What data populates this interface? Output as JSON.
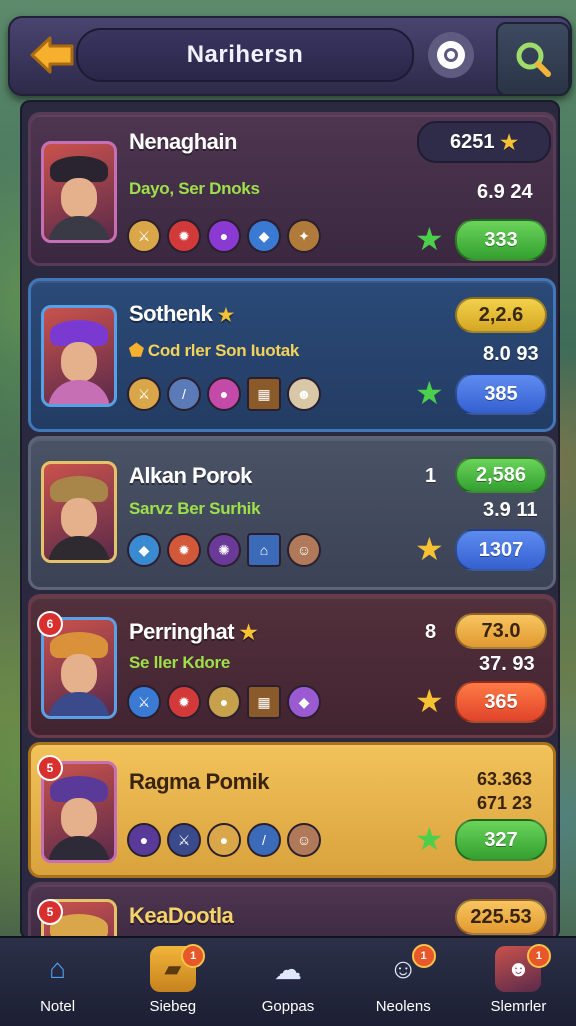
{
  "header": {
    "title": "Narihersn"
  },
  "cards": [
    {
      "name": "Nenaghain",
      "sub": "Dayo, Ser Dnoks",
      "value_top": "6251",
      "value_mid": "6.9 24",
      "button": "333",
      "sub_color": "#9ee04a"
    },
    {
      "name": "Sothenk",
      "sub": "Cod rler Son Iuotak",
      "value_top": "2,2.6",
      "value_mid": "8.0 93",
      "button": "385",
      "sub_color": "#f4d35a"
    },
    {
      "name": "Alkan Porok",
      "sub": "Sarvz Ber Surhik",
      "rank": "1",
      "value_top": "2,586",
      "value_mid": "3.9 11",
      "button": "1307",
      "sub_color": "#9ee04a"
    },
    {
      "name": "Perringhat",
      "sub": "Se ller Kdore",
      "rank": "8",
      "value_top": "73.0",
      "value_mid": "37. 93",
      "button": "365",
      "sub_color": "#9ee04a",
      "badge": "6"
    },
    {
      "name": "Ragma Pomik",
      "sub": "",
      "value_top": "63.363",
      "value_mid": "671 23",
      "button": "327",
      "badge": "5"
    },
    {
      "name": "KeaDootla",
      "value_top": "225.53",
      "badge": "5"
    }
  ],
  "nav": [
    {
      "label": "Notel",
      "icon": "home-icon",
      "notif": ""
    },
    {
      "label": "Siebeg",
      "icon": "box-icon",
      "notif": "1"
    },
    {
      "label": "Goppas",
      "icon": "ghost-icon",
      "notif": ""
    },
    {
      "label": "Neolens",
      "icon": "face-icon",
      "notif": "1"
    },
    {
      "label": "Slemrler",
      "icon": "profile-icon",
      "notif": "1"
    }
  ]
}
